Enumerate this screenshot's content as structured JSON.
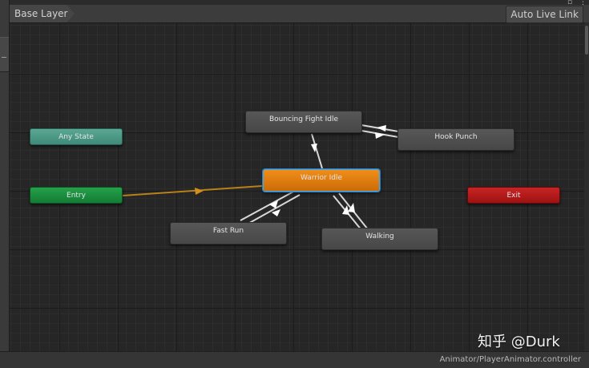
{
  "toolbar": {
    "breadcrumb": "Base Layer",
    "auto_live_link": "Auto Live Link",
    "visibility_icon": "eye-icon",
    "menu_glyphs": "⋮"
  },
  "graph": {
    "states": {
      "any_state": "Any State",
      "entry": "Entry",
      "exit": "Exit",
      "warrior_idle": "Warrior Idle",
      "bouncing_fight_idle": "Bouncing Fight Idle",
      "hook_punch": "Hook Punch",
      "fast_run": "Fast Run",
      "walking": "Walking"
    },
    "colors": {
      "default_state": "#cc6b07",
      "any_state": "#3f8a78",
      "entry": "#137c34",
      "exit": "#9e1212",
      "state": "#474747",
      "default_transition": "#b8801a",
      "transition": "#d8d8d8",
      "selection": "#4aa7e6"
    }
  },
  "footer": {
    "controller_path": "Animator/PlayerAnimator.controller"
  },
  "watermark": "知乎 @Durk"
}
